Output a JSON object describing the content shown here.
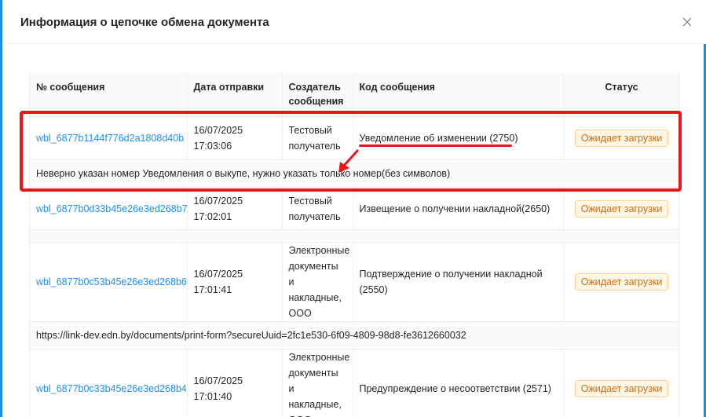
{
  "modal": {
    "title": "Информация о цепочке обмена документа",
    "close_icon": "close-icon"
  },
  "table": {
    "columns": [
      "№ сообщения",
      "Дата отправки",
      "Создатель сообщения",
      "Код сообщения",
      "Статус"
    ],
    "rows": [
      {
        "id": "wbl_6877b1144f776d2a1808d40b",
        "date": "16/07/2025",
        "time": "17:03:06",
        "creator": "Тестовый получатель",
        "code": "Уведомление об изменении (2750)",
        "status": "Ожидает загрузки",
        "note": "Неверно указан номер Уведомления о выкупе, нужно указать только номер(без символов)"
      },
      {
        "id": "wbl_6877b0d33b45e26e3ed268b7",
        "date": "16/07/2025",
        "time": "17:02:01",
        "creator": "Тестовый получатель",
        "code": "Извещение о получении накладной(2650)",
        "status": "Ожидает загрузки"
      },
      {
        "id": "wbl_6877b0c53b45e26e3ed268b6",
        "date": "16/07/2025",
        "time": "17:01:41",
        "creator": "Электронные документы и накладные, ООО",
        "code": "Подтверждение о получении накладной (2550)",
        "status": "Ожидает загрузки",
        "note": "https://link-dev.edn.by/documents/print-form?secureUuid=2fc1e530-6f09-4809-98d8-fe3612660032"
      },
      {
        "id": "wbl_6877b0c33b45e26e3ed268b4",
        "date": "16/07/2025",
        "time": "17:01:40",
        "creator": "Электронные документы и накладные, ООО",
        "code": "Предупреждение о несоответствии (2571)",
        "status": "Ожидает загрузки"
      }
    ]
  },
  "colors": {
    "link": "#1890ff",
    "annotation": "#e8141b",
    "badge_text": "#d46b08",
    "badge_bg": "#fff7e6",
    "frame_border": "#1a8fd8"
  }
}
